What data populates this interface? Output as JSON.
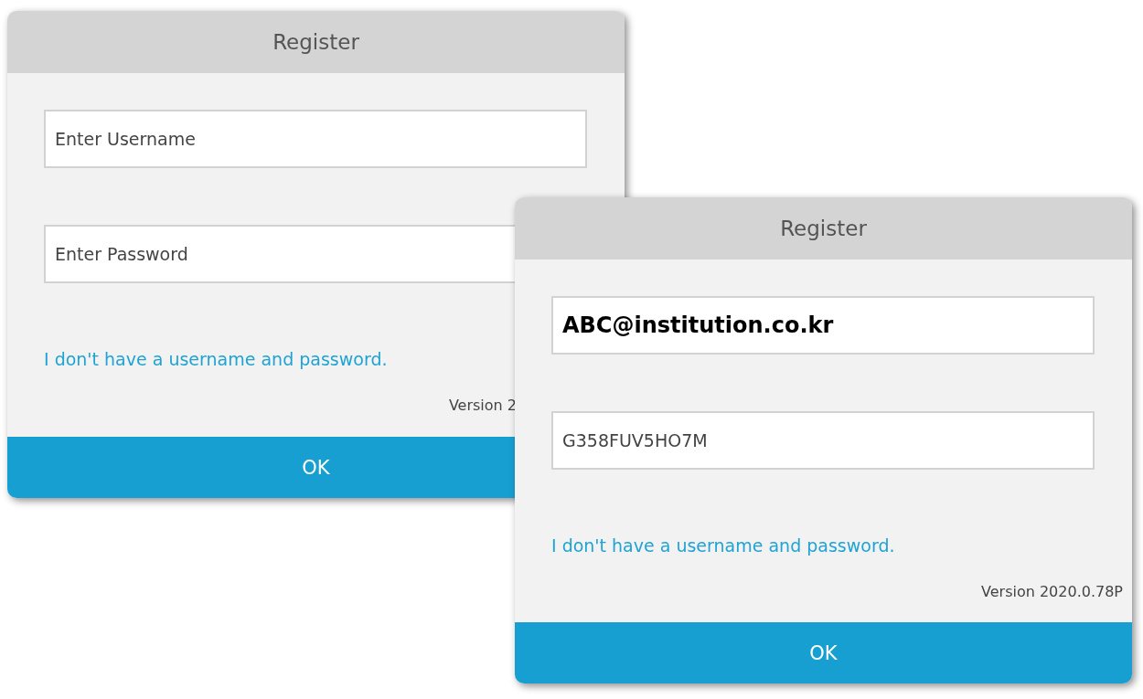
{
  "dialogs": [
    {
      "title": "Register",
      "fields": [
        {
          "placeholder": "Enter Username"
        },
        {
          "placeholder": "Enter Password"
        }
      ],
      "link": "I don't have a username and password.",
      "version": "Version 2",
      "button": "OK"
    },
    {
      "title": "Register",
      "fields": [
        {
          "value": "ABC@institution.co.kr",
          "bold": true
        },
        {
          "value": "G358FUV5HO7M",
          "bold": false
        }
      ],
      "link": "I don't have a username and password.",
      "version": "Version 2020.0.78P",
      "button": "OK"
    }
  ]
}
